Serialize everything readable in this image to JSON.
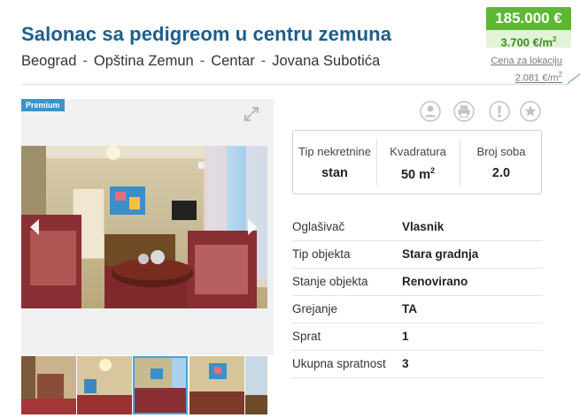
{
  "listing": {
    "title": "Salonac sa pedigreom u centru zemuna",
    "breadcrumb": [
      "Beograd",
      "Opština Zemun",
      "Centar",
      "Jovana Subotića"
    ],
    "price": "185.000 €",
    "price_per_m2": "3.700 €/m",
    "price_per_m2_sup": "2",
    "location_price_label": "Cena za lokaciju",
    "location_price_value": "2.081 €/m",
    "location_price_sup": "2"
  },
  "gallery": {
    "badge": "Premium",
    "thumbnail_count_visible": 5,
    "active_thumbnail": 3
  },
  "actions": [
    "contact-icon",
    "print-icon",
    "report-icon",
    "favorite-icon"
  ],
  "stats": [
    {
      "label": "Tip nekretnine",
      "value": "stan"
    },
    {
      "label": "Kvadratura",
      "value": "50 m",
      "sup": "2"
    },
    {
      "label": "Broj soba",
      "value": "2.0"
    }
  ],
  "details": [
    {
      "label": "Oglašivač",
      "value": "Vlasnik"
    },
    {
      "label": "Tip objekta",
      "value": "Stara gradnja"
    },
    {
      "label": "Stanje objekta",
      "value": "Renovirano"
    },
    {
      "label": "Grejanje",
      "value": "TA"
    },
    {
      "label": "Sprat",
      "value": "1"
    },
    {
      "label": "Ukupna spratnost",
      "value": "3"
    }
  ],
  "colors": {
    "title": "#1b5e8e",
    "price_bg": "#5cb833",
    "price_m2_bg": "#e3f3d9",
    "premium_badge": "#3a93c9",
    "active_thumb_border": "#4aa3d8"
  }
}
